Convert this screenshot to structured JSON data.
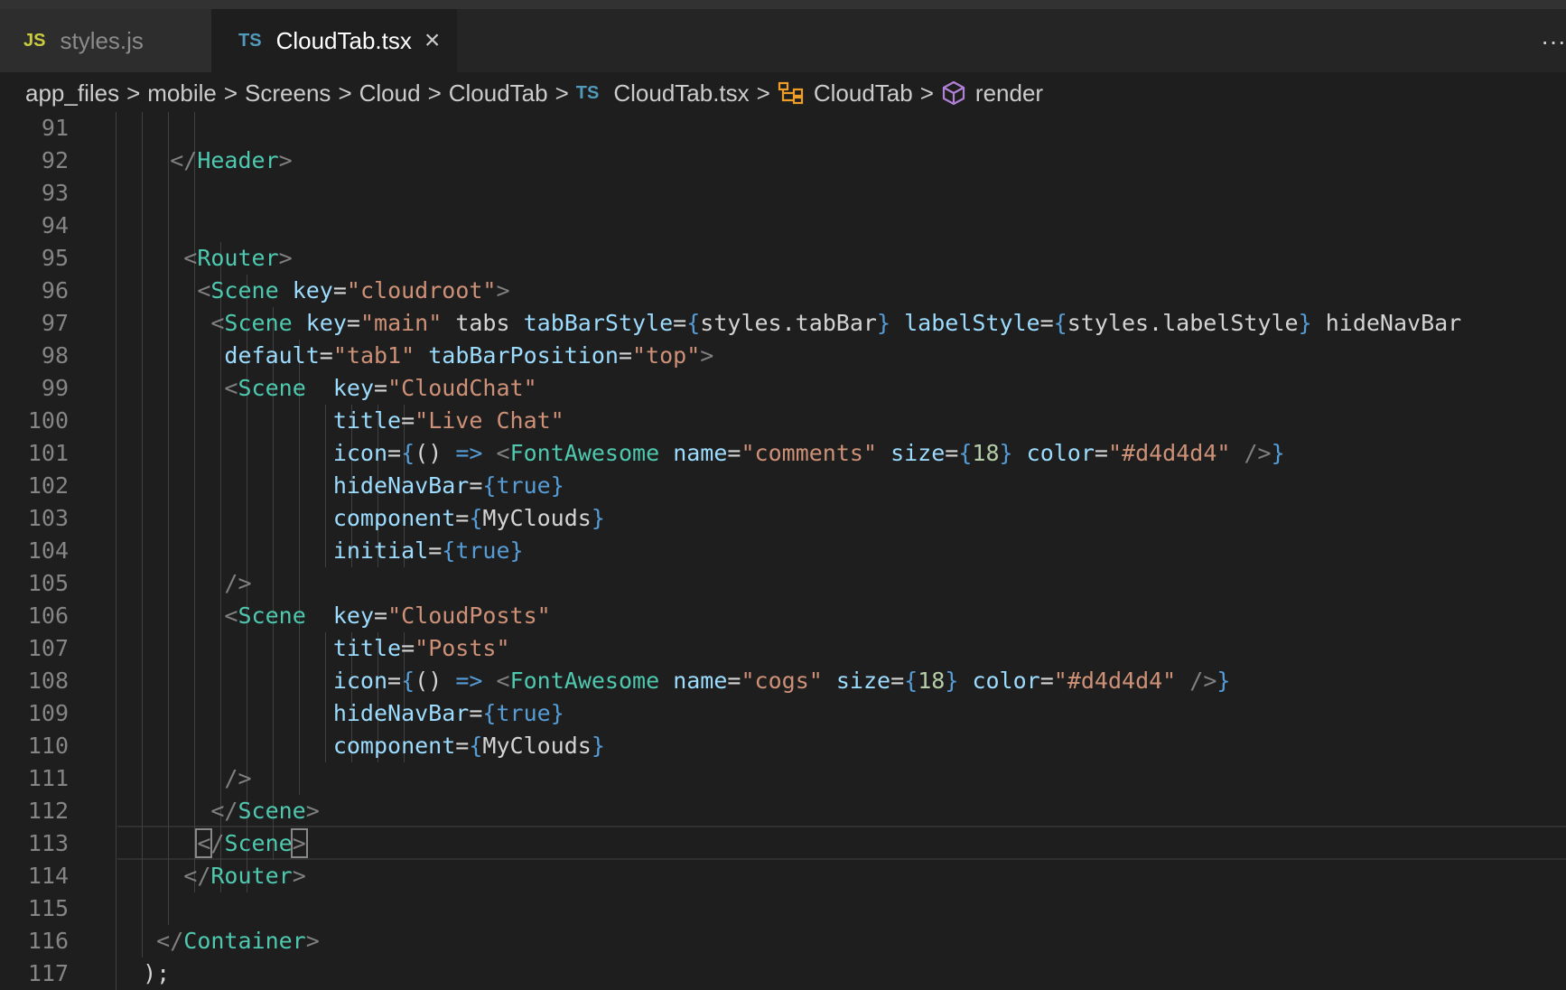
{
  "tabs": [
    {
      "badge": "JS",
      "label": "styles.js"
    },
    {
      "badge": "TS",
      "label": "CloudTab.tsx",
      "close": "×"
    }
  ],
  "more_actions": "···",
  "breadcrumbs": {
    "segments": [
      "app_files",
      "mobile",
      "Screens",
      "Cloud",
      "CloudTab"
    ],
    "file_badge": "TS",
    "file": "CloudTab.tsx",
    "symbol_class": "CloudTab",
    "symbol_method": "render",
    "separator": ">"
  },
  "editor": {
    "lines": [
      {
        "n": "91",
        "t": ""
      },
      {
        "n": "92",
        "t": "    </Header>"
      },
      {
        "n": "93",
        "t": ""
      },
      {
        "n": "94",
        "t": ""
      },
      {
        "n": "95",
        "t": "     <Router>"
      },
      {
        "n": "96",
        "t": "      <Scene key=\"cloudroot\">"
      },
      {
        "n": "97",
        "t": "       <Scene key=\"main\" tabs tabBarStyle={styles.tabBar} labelStyle={styles.labelStyle} hideNavBar"
      },
      {
        "n": "98",
        "t": "        default=\"tab1\" tabBarPosition=\"top\">"
      },
      {
        "n": "99",
        "t": "        <Scene  key=\"CloudChat\""
      },
      {
        "n": "100",
        "t": "                title=\"Live Chat\""
      },
      {
        "n": "101",
        "t": "                icon={() => <FontAwesome name=\"comments\" size={18} color=\"#d4d4d4\" />}"
      },
      {
        "n": "102",
        "t": "                hideNavBar={true}"
      },
      {
        "n": "103",
        "t": "                component={MyClouds}"
      },
      {
        "n": "104",
        "t": "                initial={true}"
      },
      {
        "n": "105",
        "t": "        />"
      },
      {
        "n": "106",
        "t": "        <Scene  key=\"CloudPosts\""
      },
      {
        "n": "107",
        "t": "                title=\"Posts\""
      },
      {
        "n": "108",
        "t": "                icon={() => <FontAwesome name=\"cogs\" size={18} color=\"#d4d4d4\" />}"
      },
      {
        "n": "109",
        "t": "                hideNavBar={true}"
      },
      {
        "n": "110",
        "t": "                component={MyClouds}"
      },
      {
        "n": "111",
        "t": "        />"
      },
      {
        "n": "112",
        "t": "       </Scene>"
      },
      {
        "n": "113",
        "t": "      </Scene>"
      },
      {
        "n": "114",
        "t": "     </Router>"
      },
      {
        "n": "115",
        "t": ""
      },
      {
        "n": "116",
        "t": "   </Container>"
      },
      {
        "n": "117",
        "t": "  );"
      }
    ]
  },
  "colors": {
    "background": "#1e1e1e",
    "tag": "#4ec9b0",
    "attribute": "#9cdcfe",
    "string": "#ce9178",
    "number": "#b5cea8",
    "keyword": "#569cd6",
    "punctuation": "#808080"
  }
}
